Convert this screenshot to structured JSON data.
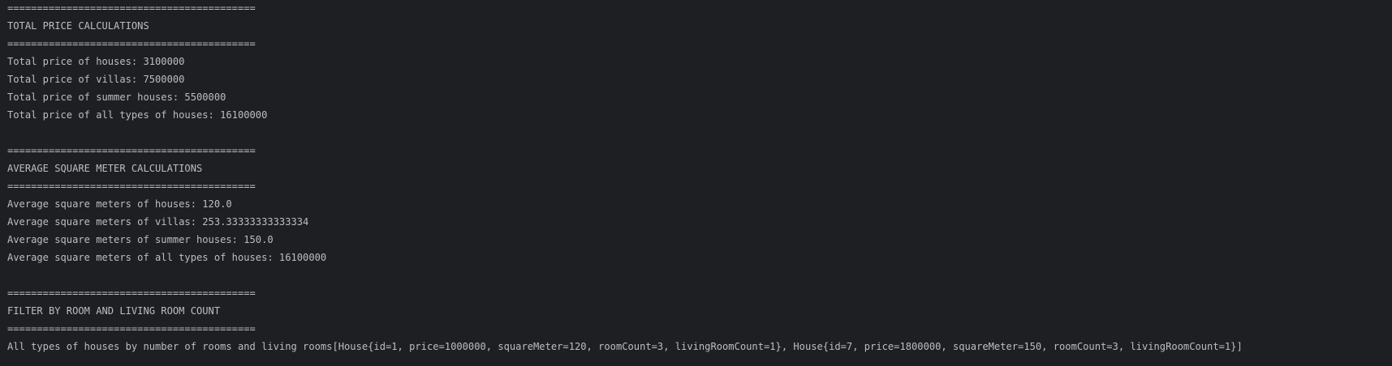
{
  "console": {
    "separator": "==========================================",
    "total_price": {
      "heading": "TOTAL PRICE CALCULATIONS",
      "houses": "Total price of houses: 3100000",
      "villas": "Total price of villas: 7500000",
      "summer_houses": "Total price of summer houses: 5500000",
      "all_types": "Total price of all types of houses: 16100000"
    },
    "average_square_meter": {
      "heading": "AVERAGE SQUARE METER CALCULATIONS",
      "houses": "Average square meters of houses: 120.0",
      "villas": "Average square meters of villas: 253.33333333333334",
      "summer_houses": "Average square meters of summer houses: 150.0",
      "all_types": "Average square meters of all types of houses: 16100000"
    },
    "filter": {
      "heading": "FILTER BY ROOM AND LIVING ROOM COUNT",
      "result": "All types of houses by number of rooms and living rooms[House{id=1, price=1000000, squareMeter=120, roomCount=3, livingRoomCount=1}, House{id=7, price=1800000, squareMeter=150, roomCount=3, livingRoomCount=1}]"
    }
  }
}
